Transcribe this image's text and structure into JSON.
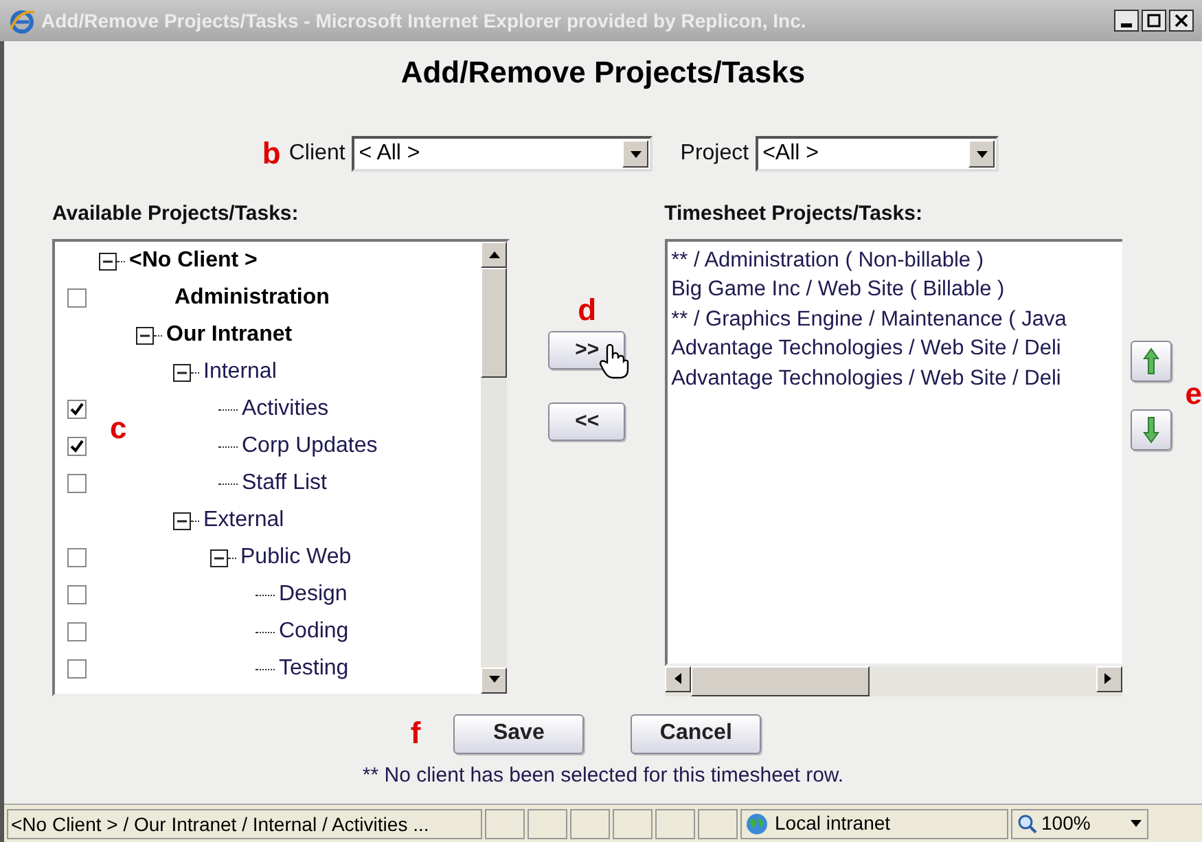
{
  "window": {
    "title": "Add/Remove Projects/Tasks - Microsoft Internet Explorer provided by Replicon, Inc."
  },
  "heading": "Add/Remove Projects/Tasks",
  "filters": {
    "marker": "b",
    "fields": [
      {
        "label": "Client",
        "value": "< All >"
      },
      {
        "label": "Project",
        "value": "<All >"
      }
    ]
  },
  "available": {
    "label": "Available Projects/Tasks:",
    "marker": "c",
    "tree": [
      {
        "kind": "client",
        "label": "<No Client >",
        "expanded": true,
        "children": [
          {
            "kind": "project",
            "label": "Administration",
            "checked": false
          },
          {
            "kind": "project",
            "label": "Our Intranet",
            "expanded": true,
            "children": [
              {
                "kind": "folder",
                "label": "Internal",
                "expanded": true,
                "children": [
                  {
                    "kind": "task",
                    "label": "Activities",
                    "checked": true
                  },
                  {
                    "kind": "task",
                    "label": "Corp Updates",
                    "checked": true
                  },
                  {
                    "kind": "task",
                    "label": "Staff List",
                    "checked": false
                  }
                ]
              },
              {
                "kind": "folder",
                "label": "External",
                "expanded": true,
                "children": [
                  {
                    "kind": "folder",
                    "label": "Public Web",
                    "expanded": true,
                    "checked": false,
                    "children": [
                      {
                        "kind": "task",
                        "label": "Design",
                        "checked": false
                      },
                      {
                        "kind": "task",
                        "label": "Coding",
                        "checked": false
                      },
                      {
                        "kind": "task",
                        "label": "Testing",
                        "checked": false
                      }
                    ]
                  }
                ]
              }
            ]
          }
        ]
      }
    ]
  },
  "move_buttons": {
    "marker": "d",
    "add": ">>",
    "remove": "<<"
  },
  "timesheet": {
    "label": "Timesheet Projects/Tasks:",
    "items": [
      "** / Administration ( Non-billable )",
      "Big Game Inc / Web Site ( Billable )",
      "** / Graphics Engine / Maintenance ( Java",
      "Advantage Technologies / Web Site / Deli",
      "Advantage Technologies / Web Site / Deli"
    ]
  },
  "order_buttons": {
    "marker": "e"
  },
  "actions": {
    "marker": "f",
    "buttons": [
      "Save",
      "Cancel"
    ]
  },
  "note": "** No client has been selected for this timesheet row.",
  "status_bar": {
    "path": "<No Client > / Our Intranet / Internal / Activities ...",
    "zone": "Local intranet",
    "zoom": "100%"
  }
}
